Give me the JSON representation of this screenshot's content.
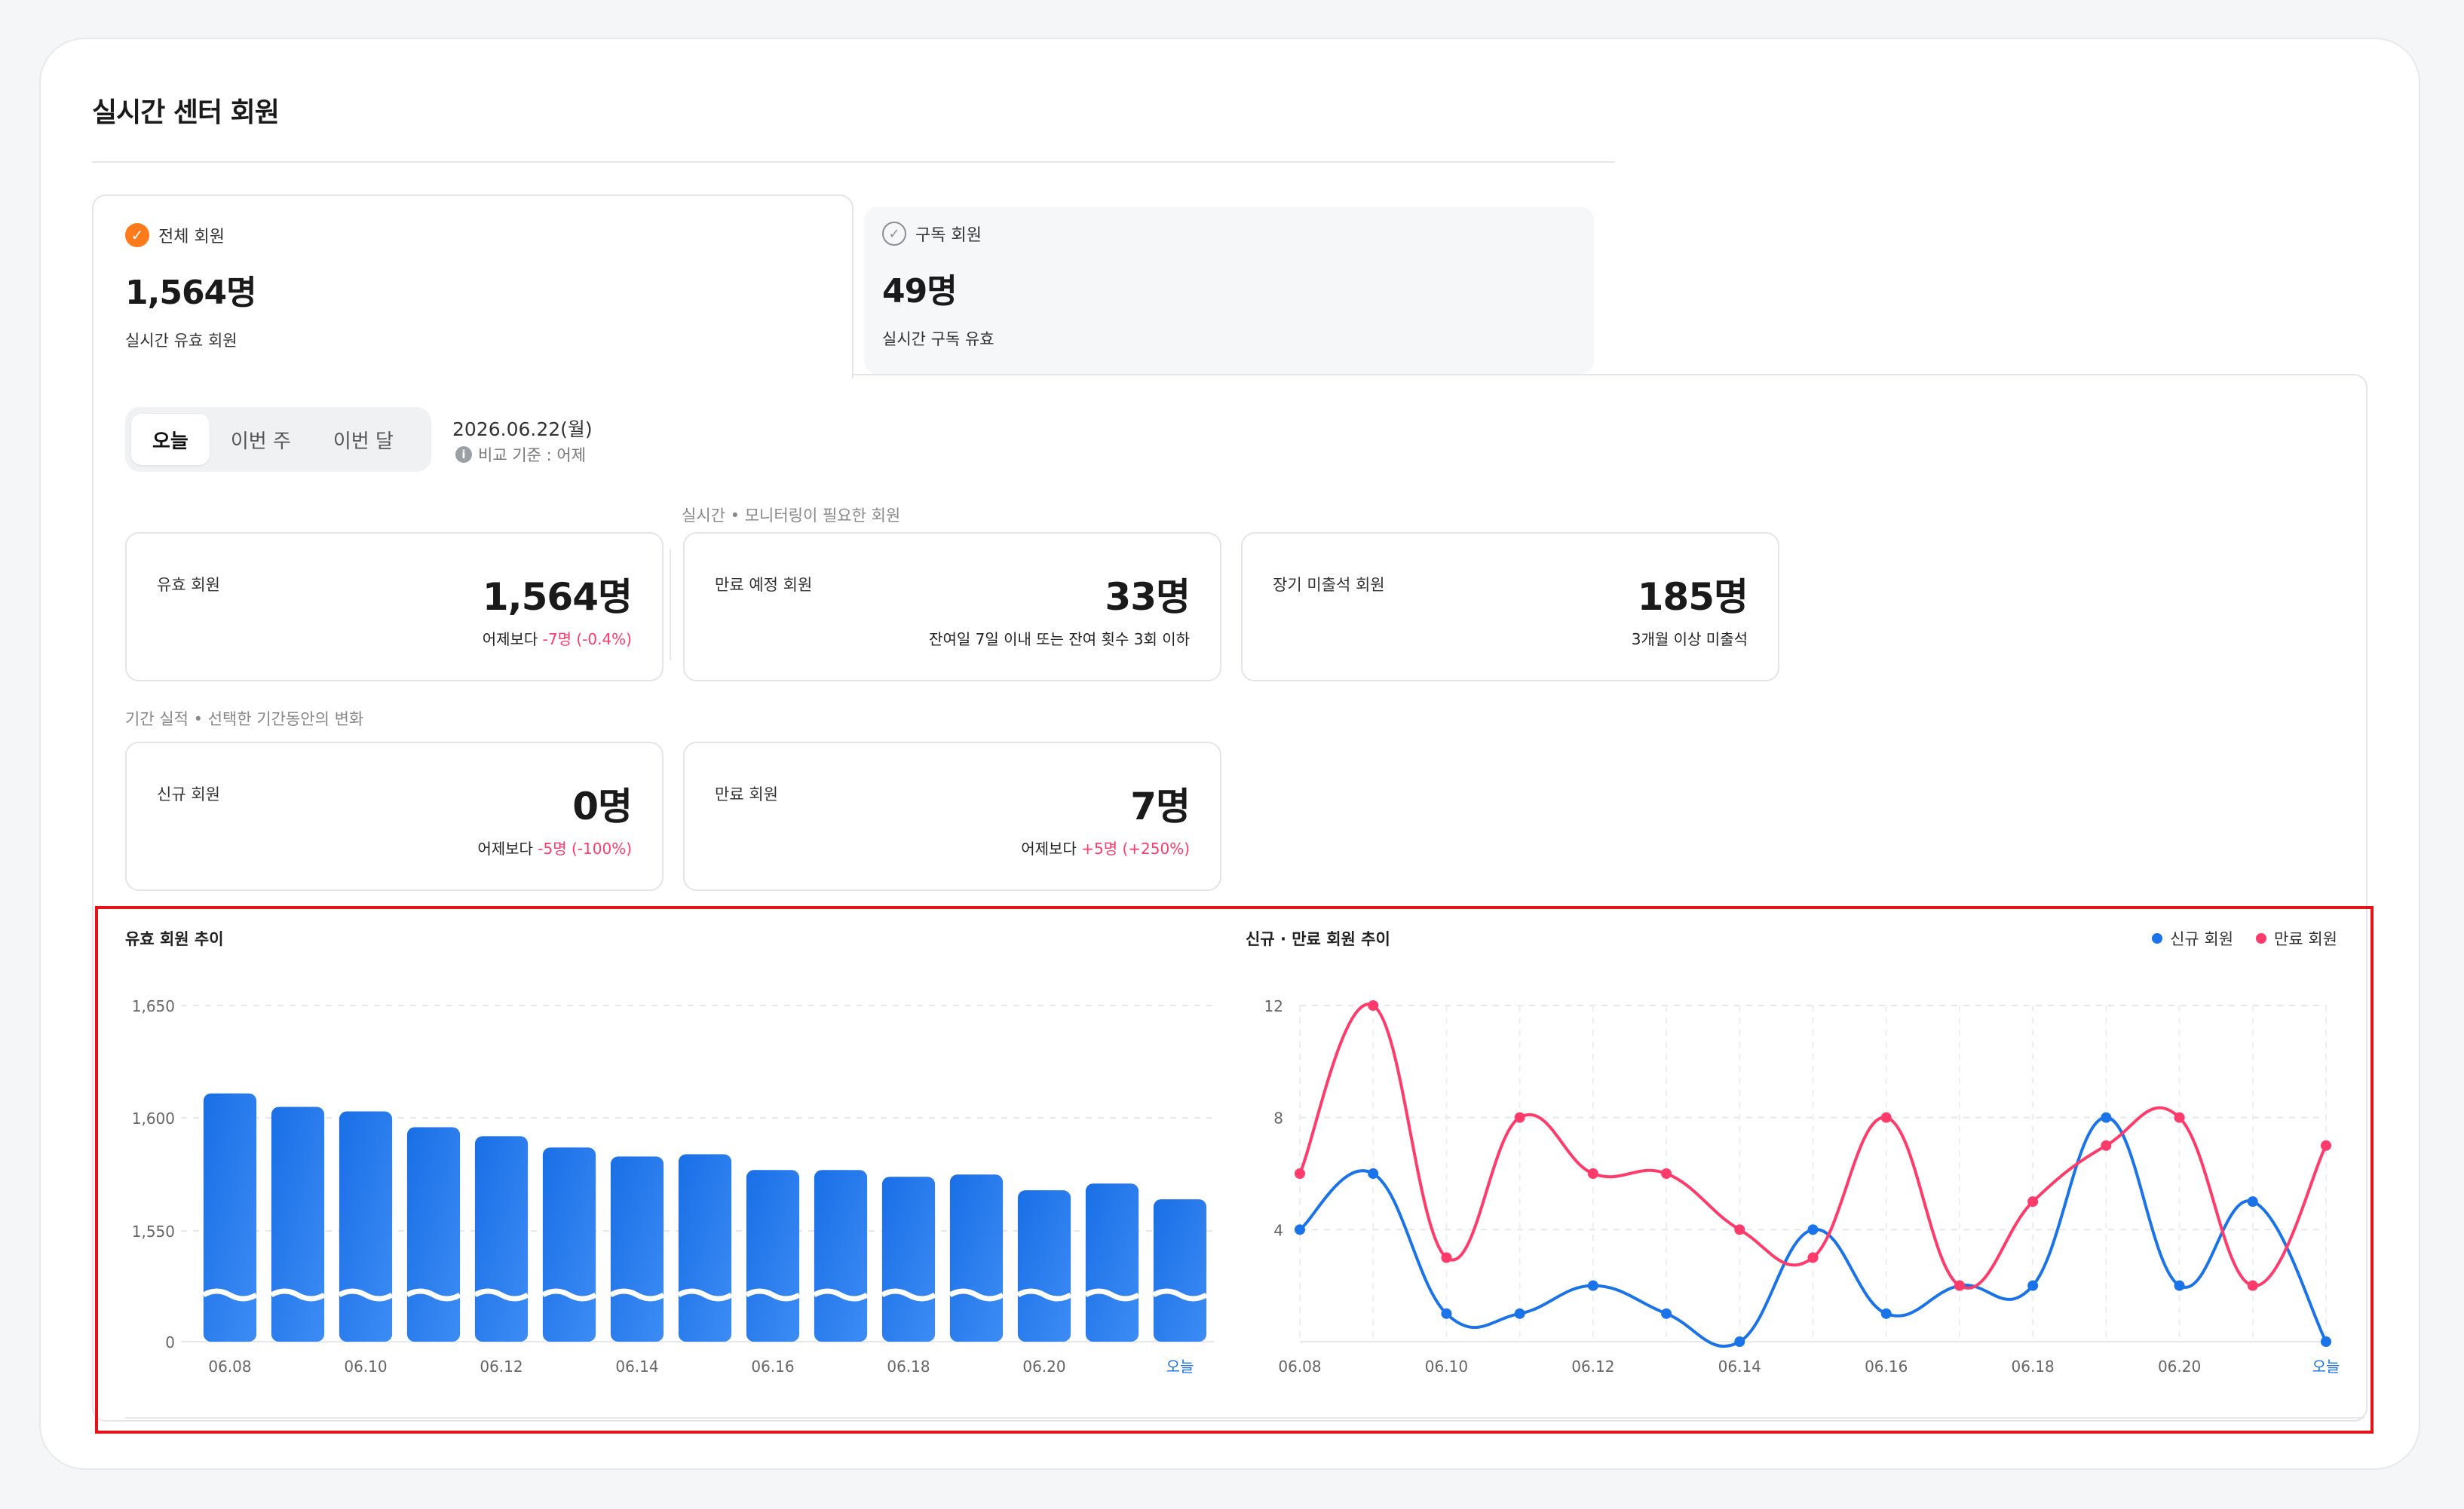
{
  "page_title": "실시간 센터 회원",
  "member_tabs": [
    {
      "label": "전체 회원",
      "value": "1,564명",
      "sub": "실시간 유효 회원"
    },
    {
      "label": "구독 회원",
      "value": "49명",
      "sub": "실시간 구독 유효"
    }
  ],
  "period_tabs": [
    "오늘",
    "이번 주",
    "이번 달"
  ],
  "date": "2026.06.22(월)",
  "compare_basis": "비교 기준 : 어제",
  "section_realtime": "실시간 • 모니터링이 필요한 회원",
  "section_period": "기간 실적 • 선택한 기간동안의 변화",
  "stats": {
    "valid": {
      "label": "유효 회원",
      "value": "1,564명",
      "note_prefix": "어제보다 ",
      "note_change": "-7명 (-0.4%)"
    },
    "expiring": {
      "label": "만료 예정 회원",
      "value": "33명",
      "note": "잔여일 7일 이내 또는 잔여 횟수 3회 이하"
    },
    "absent": {
      "label": "장기 미출석 회원",
      "value": "185명",
      "note": "3개월 이상 미출석"
    },
    "new": {
      "label": "신규 회원",
      "value": "0명",
      "note_prefix": "어제보다 ",
      "note_change": "-5명 (-100%)"
    },
    "expired": {
      "label": "만료 회원",
      "value": "7명",
      "note_prefix": "어제보다 ",
      "note_change": "+5명 (+250%)"
    }
  },
  "colors": {
    "accent_orange": "#ff7a1a",
    "blue": "#1a73e8",
    "pink": "#ff3b6b",
    "highlight_red": "#e5141b"
  },
  "chart_data": [
    {
      "type": "bar",
      "title": "유효 회원 추이",
      "categories": [
        "06.08",
        "06.09",
        "06.10",
        "06.11",
        "06.12",
        "06.13",
        "06.14",
        "06.15",
        "06.16",
        "06.17",
        "06.18",
        "06.19",
        "06.20",
        "06.21",
        "오늘"
      ],
      "values": [
        1611,
        1605,
        1603,
        1596,
        1592,
        1587,
        1583,
        1584,
        1577,
        1577,
        1574,
        1575,
        1568,
        1571,
        1564
      ],
      "ytick_labels": [
        "0",
        "1,550",
        "1,600",
        "1,650"
      ],
      "x_labeled": [
        "06.08",
        "06.10",
        "06.12",
        "06.14",
        "06.16",
        "06.18",
        "06.20",
        "오늘"
      ],
      "ylim": [
        1520,
        1650
      ],
      "axis_break": true
    },
    {
      "type": "line",
      "title": "신규 · 만료 회원 추이",
      "categories": [
        "06.08",
        "06.09",
        "06.10",
        "06.11",
        "06.12",
        "06.13",
        "06.14",
        "06.15",
        "06.16",
        "06.17",
        "06.18",
        "06.19",
        "06.20",
        "06.21",
        "오늘"
      ],
      "x_labeled": [
        "06.08",
        "06.10",
        "06.12",
        "06.14",
        "06.16",
        "06.18",
        "06.20",
        "오늘"
      ],
      "ylim": [
        0,
        12
      ],
      "yticks": [
        4,
        8,
        12
      ],
      "legend": "top-right",
      "series": [
        {
          "name": "신규 회원",
          "color": "#1a73e8",
          "values": [
            4,
            6,
            1,
            1,
            2,
            1,
            0,
            4,
            1,
            2,
            2,
            8,
            2,
            5,
            0
          ]
        },
        {
          "name": "만료 회원",
          "color": "#ff3b6b",
          "values": [
            6,
            12,
            3,
            8,
            6,
            6,
            4,
            3,
            8,
            2,
            5,
            7,
            8,
            2,
            7
          ]
        }
      ]
    }
  ]
}
